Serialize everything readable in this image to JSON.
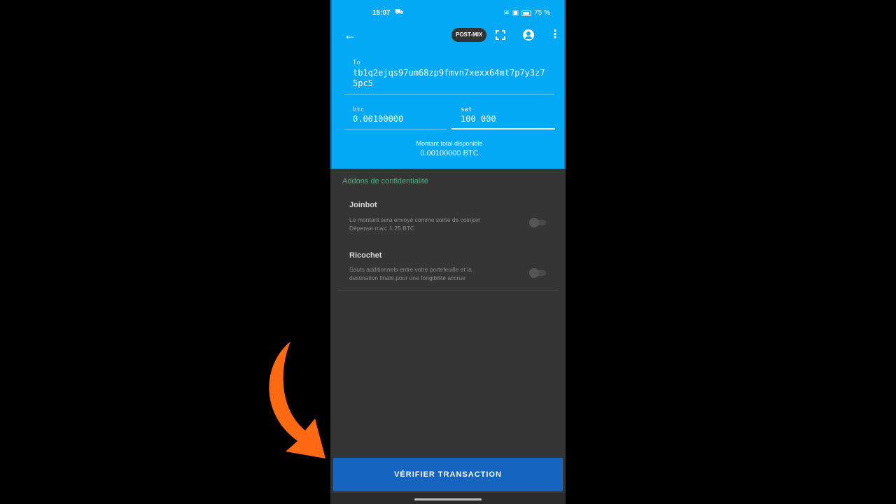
{
  "status_bar": {
    "time": "15:07",
    "extra": "⛟",
    "battery_pct": "75 %"
  },
  "toolbar": {
    "back_icon": "←",
    "postmix_label": "POST-MIX",
    "menu_icon": "⋮"
  },
  "form": {
    "to_label": "To",
    "address": "tb1q2ejqs97um68zp9fmvn7xexx64mt7p7y3z75pc5",
    "btc_label": "btc",
    "btc_value": "0.00100000",
    "sat_label": "sat",
    "sat_value": "100 000",
    "total_label": "Montant total disponible",
    "total_value": "0.00100000 BTC"
  },
  "privacy": {
    "section_title": "Addons de confidentialité",
    "joinbot": {
      "title": "Joinbot",
      "desc_line1": "Le montant sera envoyé comme sortie de coinjoin",
      "desc_line2": "Dépense max: 1.25 BTC",
      "enabled": false
    },
    "ricochet": {
      "title": "Ricochet",
      "desc_line1": "Sauts additionnels entre votre portefeuille et la",
      "desc_line2": "destination finale pour une fongibilité accrue",
      "enabled": false
    }
  },
  "actions": {
    "verify_label": "VÉRIFIER TRANSACTION"
  },
  "colors": {
    "header": "#03a9f4",
    "background": "#353535",
    "button": "#1565c0",
    "accent": "#4caf7d",
    "arrow": "#ff6a13"
  }
}
